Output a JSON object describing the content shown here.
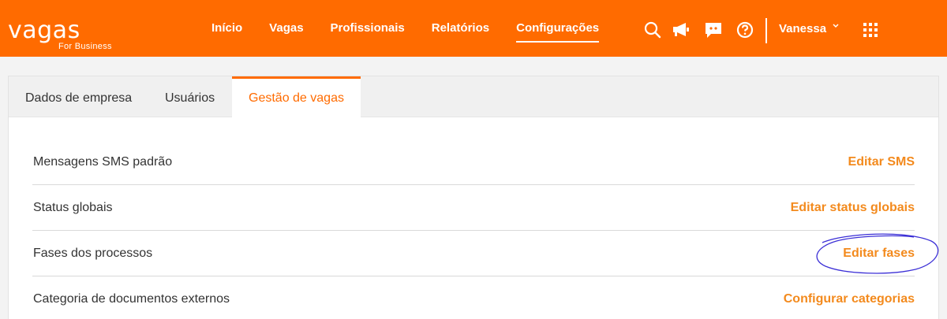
{
  "header": {
    "logo_text": "vagas",
    "logo_sub": "For Business",
    "nav": [
      {
        "label": "Início"
      },
      {
        "label": "Vagas"
      },
      {
        "label": "Profissionais"
      },
      {
        "label": "Relatórios"
      },
      {
        "label": "Configurações",
        "active": true
      }
    ],
    "icons": [
      "search-icon",
      "megaphone-icon",
      "chat-icon",
      "help-icon",
      "apps-grid-icon"
    ],
    "user_name": "Vanessa",
    "colors": {
      "brand": "#ff6b00",
      "accent_text": "#f38a1d"
    }
  },
  "tabs": [
    {
      "label": "Dados de empresa"
    },
    {
      "label": "Usuários"
    },
    {
      "label": "Gestão de vagas",
      "active": true
    }
  ],
  "settings": [
    {
      "label": "Mensagens SMS padrão",
      "action": "Editar SMS"
    },
    {
      "label": "Status globais",
      "action": "Editar status globais"
    },
    {
      "label": "Fases dos processos",
      "action": "Editar fases"
    },
    {
      "label": "Categoria de documentos externos",
      "action": "Configurar categorias"
    }
  ]
}
